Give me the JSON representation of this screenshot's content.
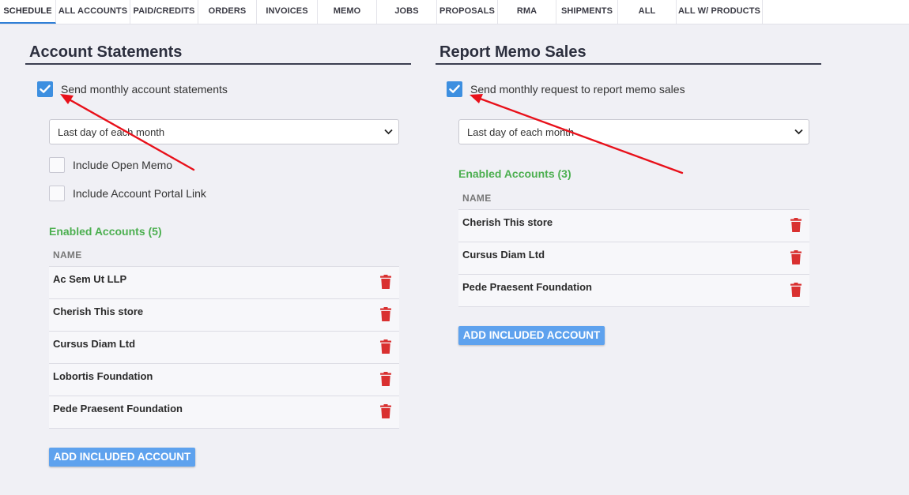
{
  "tabs": [
    {
      "label": "SCHEDULE",
      "active": true
    },
    {
      "label": "ALL ACCOUNTS"
    },
    {
      "label": "PAID/CREDITS"
    },
    {
      "label": "ORDERS"
    },
    {
      "label": "INVOICES"
    },
    {
      "label": "MEMO"
    },
    {
      "label": "JOBS"
    },
    {
      "label": "PROPOSALS"
    },
    {
      "label": "RMA"
    },
    {
      "label": "SHIPMENTS"
    },
    {
      "label": "ALL"
    },
    {
      "label": "ALL W/ PRODUCTS"
    }
  ],
  "account_statements": {
    "title": "Account Statements",
    "send_label": "Send monthly account statements",
    "send_checked": true,
    "schedule_value": "Last day of each month",
    "include_open_memo_label": "Include Open Memo",
    "include_portal_link_label": "Include Account Portal Link",
    "enabled_title": "Enabled Accounts (5)",
    "column_name": "NAME",
    "accounts": [
      {
        "name": "Ac Sem Ut LLP"
      },
      {
        "name": "Cherish This store"
      },
      {
        "name": "Cursus Diam Ltd"
      },
      {
        "name": "Lobortis Foundation"
      },
      {
        "name": "Pede Praesent Foundation"
      }
    ],
    "add_button": "ADD INCLUDED ACCOUNT"
  },
  "report_memo_sales": {
    "title": "Report Memo Sales",
    "send_label": "Send monthly request to report memo sales",
    "send_checked": true,
    "schedule_value": "Last day of each month",
    "enabled_title": "Enabled Accounts (3)",
    "column_name": "NAME",
    "accounts": [
      {
        "name": "Cherish This store"
      },
      {
        "name": "Cursus Diam Ltd"
      },
      {
        "name": "Pede Praesent Foundation"
      }
    ],
    "add_button": "ADD INCLUDED ACCOUNT"
  },
  "colors": {
    "accent": "#3d8fe0",
    "enabled_green": "#4caf50",
    "delete_red": "#d93030",
    "annotation_red": "#e8101a"
  }
}
